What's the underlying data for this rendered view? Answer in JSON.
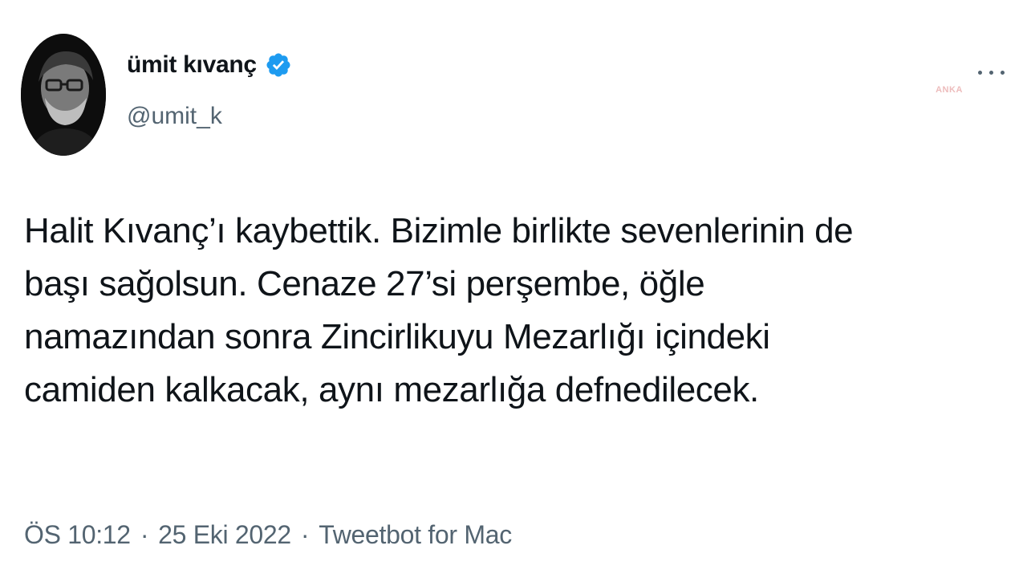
{
  "author": {
    "display_name": "ümit kıvanç",
    "handle": "@umit_k",
    "verified": true,
    "verified_color": "#1d9bf0"
  },
  "tweet": {
    "text": "Halit Kıvanç’ı kaybettik. Bizimle birlikte sevenlerinin de\nbaşı sağolsun. Cenaze 27’si perşembe, öğle\nnamazından sonra Zincirlikuyu Mezarlığı içindeki\ncamiden kalkacak, aynı mezarlığa defnedilecek."
  },
  "meta": {
    "time": "ÖS 10:12",
    "separator": "·",
    "date": "25 Eki 2022",
    "source": "Tweetbot for Mac"
  },
  "watermark": {
    "text": "ANKA"
  },
  "icons": {
    "verified": "verified-badge-icon",
    "more": "more-options-icon"
  }
}
